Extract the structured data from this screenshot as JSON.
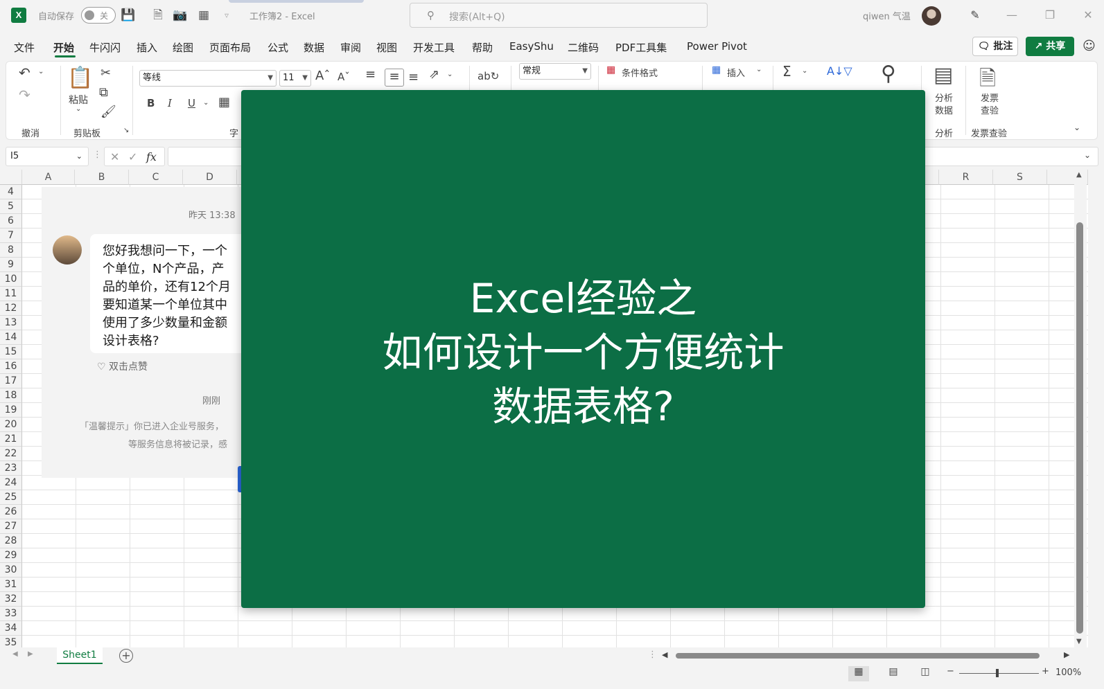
{
  "titlebar": {
    "logo_text": "X",
    "autosave_label": "自动保存",
    "autosave_state": "关",
    "document_title": "工作簿2  -  Excel",
    "search_placeholder": "搜索(Alt+Q)",
    "user_name": "qiwen 气温"
  },
  "menu": {
    "tabs": [
      "文件",
      "开始",
      "牛闪闪",
      "插入",
      "绘图",
      "页面布局",
      "公式",
      "数据",
      "审阅",
      "视图",
      "开发工具",
      "帮助",
      "EasyShu",
      "二维码",
      "PDF工具集",
      "Power Pivot"
    ],
    "active_tab": "开始",
    "comment_label": "批注",
    "share_label": "共享"
  },
  "ribbon": {
    "undo_group_label": "撤消",
    "paste_label": "粘贴",
    "clipboard_group_label": "剪贴板",
    "font_group_label_partial": "字",
    "font_name": "等线",
    "font_size": "11",
    "bold": "B",
    "italic": "I",
    "underline": "U",
    "number_format": "常规",
    "conditional_format_label": "条件格式",
    "insert_label": "插入",
    "analyze_label_line1": "分析",
    "analyze_label_line2": "数据",
    "analyze_group_label": "分析",
    "invoice_label_line1": "发票",
    "invoice_label_line2": "查验",
    "invoice_group_label": "发票查验"
  },
  "formula_bar": {
    "name_box": "I5",
    "fx": "fx"
  },
  "grid": {
    "column_headers": [
      "A",
      "B",
      "C",
      "D"
    ],
    "right_column_headers": [
      "R",
      "S"
    ],
    "row_numbers": [
      "4",
      "5",
      "6",
      "7",
      "8",
      "9",
      "10",
      "11",
      "12",
      "13",
      "14",
      "15",
      "16",
      "17",
      "18",
      "19",
      "20",
      "21",
      "22",
      "23",
      "24",
      "25",
      "26",
      "27",
      "28",
      "29",
      "30",
      "31",
      "32",
      "33",
      "34",
      "35"
    ]
  },
  "chat": {
    "time1": "昨天 13:38",
    "message_lines": [
      "您好我想问一下，一个",
      "个单位，N个产品，产",
      "品的单价，还有12个月",
      "要知道某一个单位其中",
      "使用了多少数量和金额",
      "设计表格?"
    ],
    "like_label": "双击点赞",
    "time2": "刚刚",
    "notice_line1": "「温馨提示」你已进入企业号服务，",
    "notice_line2": "等服务信息将被记录，感"
  },
  "overlay": {
    "line1": "Excel经验之",
    "line2": "如何设计一个方便统计",
    "line3": "数据表格?"
  },
  "sheets": {
    "active_sheet": "Sheet1"
  },
  "statusbar": {
    "zoom_level": "100%"
  },
  "colors": {
    "excel_green": "#107c41",
    "overlay_green": "#0c6e45"
  }
}
